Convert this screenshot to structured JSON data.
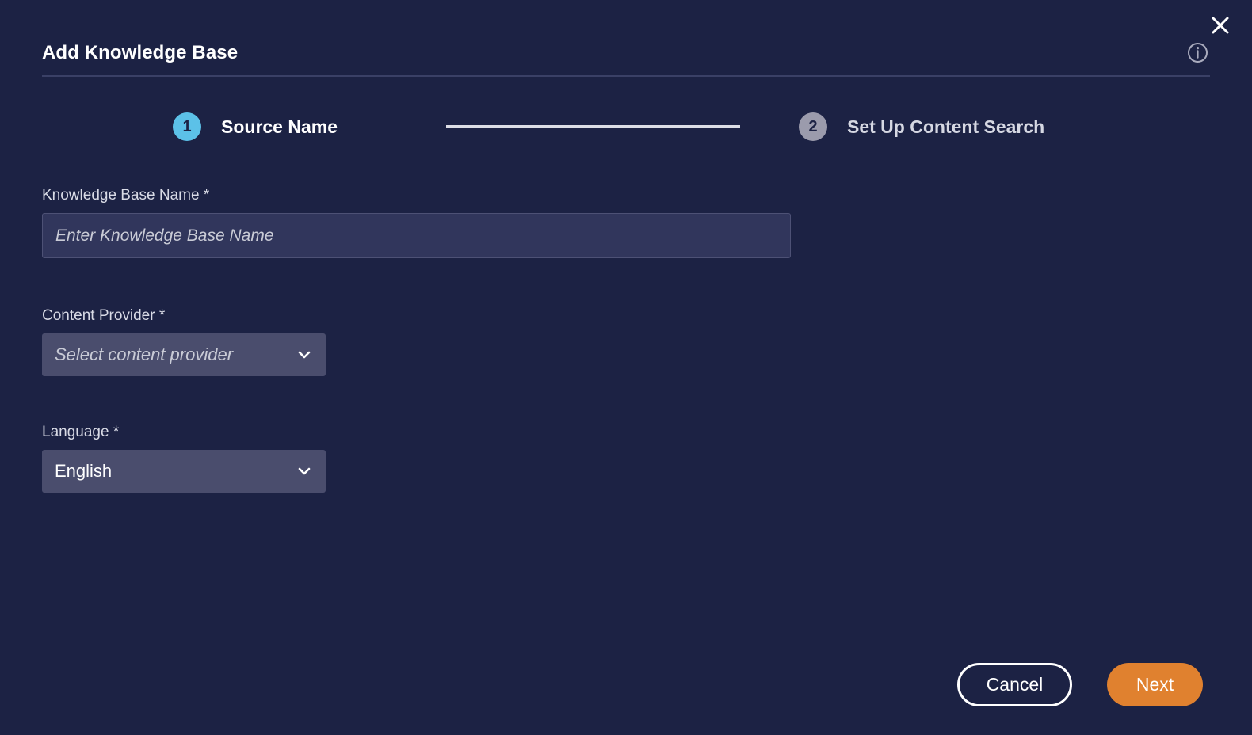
{
  "dialog": {
    "title": "Add Knowledge Base",
    "close_icon": "close-icon",
    "info_icon": "info-icon"
  },
  "stepper": {
    "steps": [
      {
        "number": "1",
        "label": "Source Name",
        "state": "active"
      },
      {
        "number": "2",
        "label": "Set Up Content Search",
        "state": "inactive"
      }
    ]
  },
  "form": {
    "knowledge_base_name": {
      "label": "Knowledge Base Name *",
      "placeholder": "Enter Knowledge Base Name",
      "value": ""
    },
    "content_provider": {
      "label": "Content Provider *",
      "placeholder": "Select content provider",
      "value": "",
      "chevron_icon": "chevron-down-icon"
    },
    "language": {
      "label": "Language *",
      "value": "English",
      "chevron_icon": "chevron-down-icon"
    }
  },
  "footer": {
    "cancel_label": "Cancel",
    "next_label": "Next"
  },
  "colors": {
    "background": "#1c2244",
    "accent_primary": "#e0812f",
    "step_active": "#5cc1e8",
    "step_inactive": "#9b9bac",
    "input_fill": "#31365c",
    "select_fill": "#4a4d6d"
  }
}
